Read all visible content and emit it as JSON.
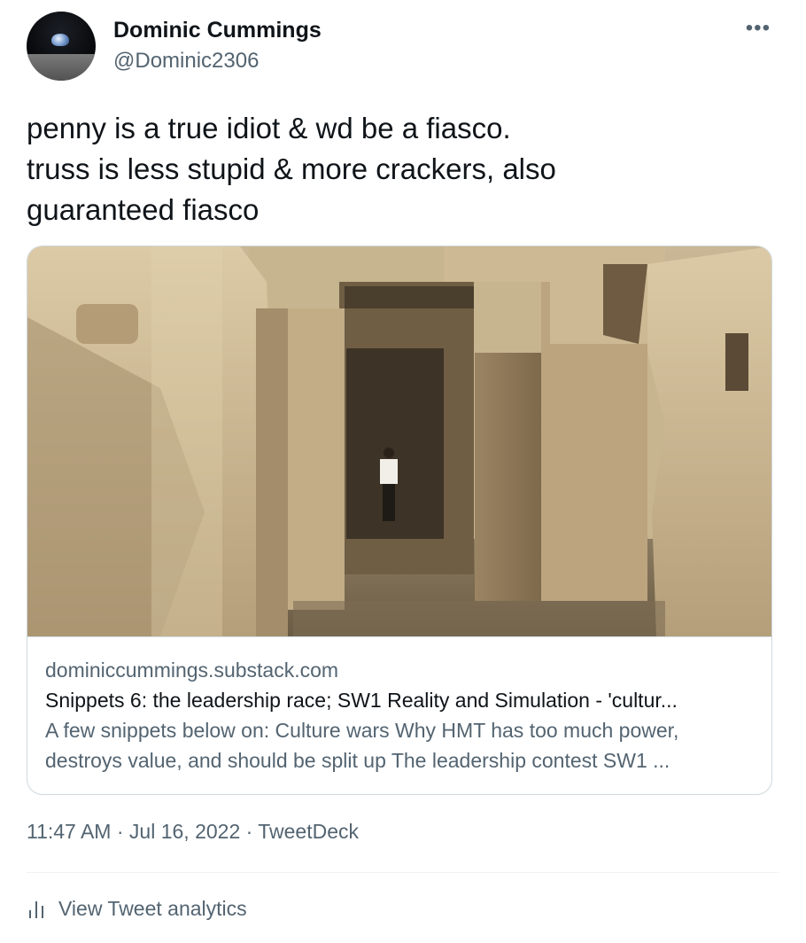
{
  "author": {
    "display_name": "Dominic Cummings",
    "handle": "@Dominic2306",
    "avatar_icon": "earthrise-avatar"
  },
  "more_menu": {
    "label": "•••",
    "icon": "more-icon"
  },
  "tweet": {
    "lines": [
      "penny is a true idiot & wd be a fiasco.",
      "truss is less stupid & more crackers, also",
      "guaranteed fiasco"
    ]
  },
  "card": {
    "image_alt": "ruins-photo",
    "domain": "dominiccummings.substack.com",
    "title": "Snippets 6: the leadership race; SW1 Reality and Simulation - 'cultur...",
    "description_lines": [
      "A few snippets below on: Culture wars Why HMT has too much power,",
      "destroys value, and should be split up The leadership contest SW1 ..."
    ]
  },
  "meta": {
    "timestamp": "11:47 AM · Jul 16, 2022 · TweetDeck"
  },
  "analytics": {
    "label": "View Tweet analytics",
    "icon": "analytics-icon"
  },
  "colors": {
    "text": "#0f1419",
    "secondary": "#536471",
    "border": "#cfd9de"
  }
}
